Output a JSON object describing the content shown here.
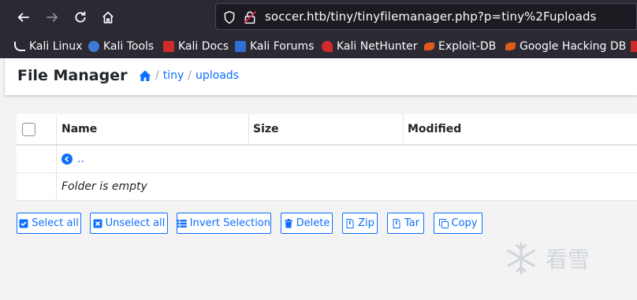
{
  "browser": {
    "url": "soccer.htb/tiny/tinyfilemanager.php?p=tiny%2Fuploads",
    "bookmarks": [
      {
        "label": "Kali Linux",
        "icon": "kali-dragon-icon",
        "color": "#fbfbfe"
      },
      {
        "label": "Kali Tools",
        "icon": "kali-tools-icon",
        "color": "#3f7bd6"
      },
      {
        "label": "Kali Docs",
        "icon": "kali-docs-icon",
        "color": "#d02b2b"
      },
      {
        "label": "Kali Forums",
        "icon": "kali-forums-icon",
        "color": "#2f6fd6"
      },
      {
        "label": "Kali NetHunter",
        "icon": "nethunter-icon",
        "color": "#d02b2b"
      },
      {
        "label": "Exploit-DB",
        "icon": "exploit-db-icon",
        "color": "#e05a1c"
      },
      {
        "label": "Google Hacking DB",
        "icon": "ghdb-icon",
        "color": "#e05a1c"
      }
    ]
  },
  "app": {
    "title": "File Manager",
    "breadcrumb": {
      "root": "tiny",
      "separator": "/",
      "current": "uploads"
    }
  },
  "table": {
    "columns": [
      "Name",
      "Size",
      "Modified"
    ],
    "parent_link": "..",
    "empty_message": "Folder is empty"
  },
  "actions": [
    {
      "label": "Select all",
      "icon": "check-square-icon"
    },
    {
      "label": "Unselect all",
      "icon": "x-square-icon"
    },
    {
      "label": "Invert Selection",
      "icon": "list-icon"
    },
    {
      "label": "Delete",
      "icon": "trash-icon"
    },
    {
      "label": "Zip",
      "icon": "file-zip-icon"
    },
    {
      "label": "Tar",
      "icon": "file-tar-icon"
    },
    {
      "label": "Copy",
      "icon": "copy-icon"
    }
  ],
  "watermark": {
    "text": "看雪"
  },
  "colors": {
    "accent": "#0d6efd",
    "chrome": "#2b2a33",
    "page_bg": "#f3f3f4"
  }
}
